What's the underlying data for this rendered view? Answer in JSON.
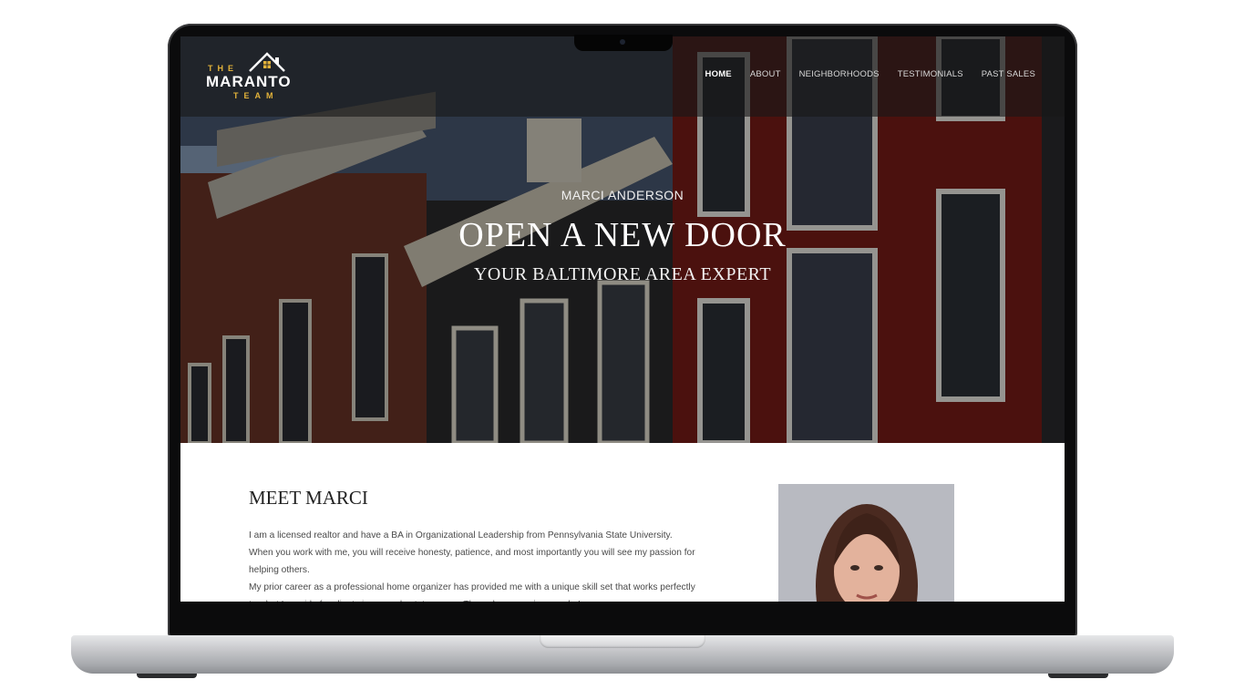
{
  "nav": {
    "logo": {
      "the": "THE",
      "name": "MARANTO",
      "team": "TEAM"
    },
    "links": [
      {
        "label": "HOME",
        "active": true
      },
      {
        "label": "ABOUT",
        "active": false
      },
      {
        "label": "NEIGHBORHOODS",
        "active": false
      },
      {
        "label": "TESTIMONIALS",
        "active": false
      },
      {
        "label": "PAST SALES",
        "active": false
      }
    ]
  },
  "hero": {
    "subtitle": "MARCI ANDERSON",
    "title": "OPEN A NEW DOOR",
    "tagline": "YOUR BALTIMORE AREA EXPERT"
  },
  "about": {
    "heading": "MEET MARCI",
    "paragraphs": [
      "I am a licensed realtor and have a BA in Organizational Leadership from Pennsylvania State University. When you work with me, you will receive honesty, patience, and most importantly you will see my passion for helping others.",
      "My prior career as a professional home organizer has provided me with a unique skill set that works perfectly to what I provide for clients in my real estate career. Through my previous work, I"
    ]
  },
  "colors": {
    "accent_gold": "#e2b23a",
    "nav_bg": "#191919",
    "brick_red": "#7a1c17",
    "text_dark": "#222222"
  },
  "icons": {
    "logo_house": "house-icon"
  }
}
